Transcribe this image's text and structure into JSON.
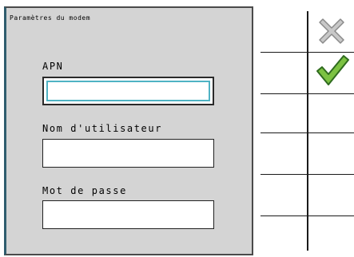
{
  "panel": {
    "title": "Paramètres du modem",
    "fields": [
      {
        "label": "APN",
        "value": ""
      },
      {
        "label": "Nom d'utilisateur",
        "value": ""
      },
      {
        "label": "Mot de passe",
        "value": ""
      }
    ]
  },
  "softkeys": {
    "cancel_icon": "close-icon",
    "confirm_icon": "checkmark-icon",
    "colors": {
      "cancel": "#bdbdbd",
      "confirm": "#7cc242"
    }
  }
}
